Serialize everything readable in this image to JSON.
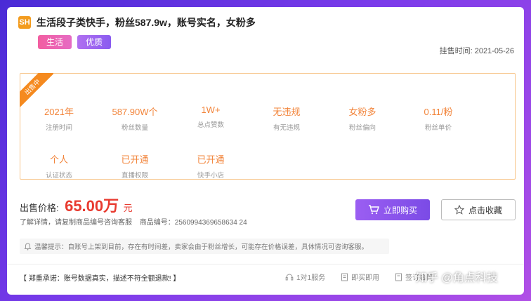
{
  "listing": {
    "logo_text": "SH",
    "title": "生活段子类快手，粉丝587.9w，账号实名，女粉多",
    "tags": [
      "生活",
      "优质"
    ],
    "list_date": "挂售时间: 2021-05-26",
    "ribbon": "出售中"
  },
  "stats": [
    {
      "value": "2021年",
      "label": "注册时间"
    },
    {
      "value": "587.90W个",
      "label": "粉丝数量"
    },
    {
      "value": "1W+",
      "label": "总点赞数"
    },
    {
      "value": "无违规",
      "label": "有无违规"
    },
    {
      "value": "女粉多",
      "label": "粉丝偏向"
    },
    {
      "value": "0.11/粉",
      "label": "粉丝单价"
    },
    {
      "value": "个人",
      "label": "认证状态"
    },
    {
      "value": "已开通",
      "label": "直播权限"
    },
    {
      "value": "已开通",
      "label": "快手小店"
    }
  ],
  "price": {
    "label": "出售价格:",
    "value": "65.00万",
    "unit": "元",
    "detail": "了解详情，请复制商品编号咨询客服",
    "code": "商品编号：2560994369658634 24"
  },
  "buttons": {
    "buy": "立即购买",
    "favorite": "点击收藏"
  },
  "tip": "温馨提示：自账号上架到目前，存在有时间差，卖家会由于粉丝增长，可能存在价格误差，具体情况可咨询客服。",
  "promise": "【 郑重承诺：账号数据真实，描述不符全额退款! 】",
  "services": [
    "1对1服务",
    "即买即用",
    "签订合同"
  ],
  "watermark": "知乎 @角点科技",
  "colors": {
    "accent_orange": "#f2843a",
    "price_red": "#e83a2f",
    "buy_purple": "#8a55ec",
    "background_purple": "#7a3bea"
  }
}
